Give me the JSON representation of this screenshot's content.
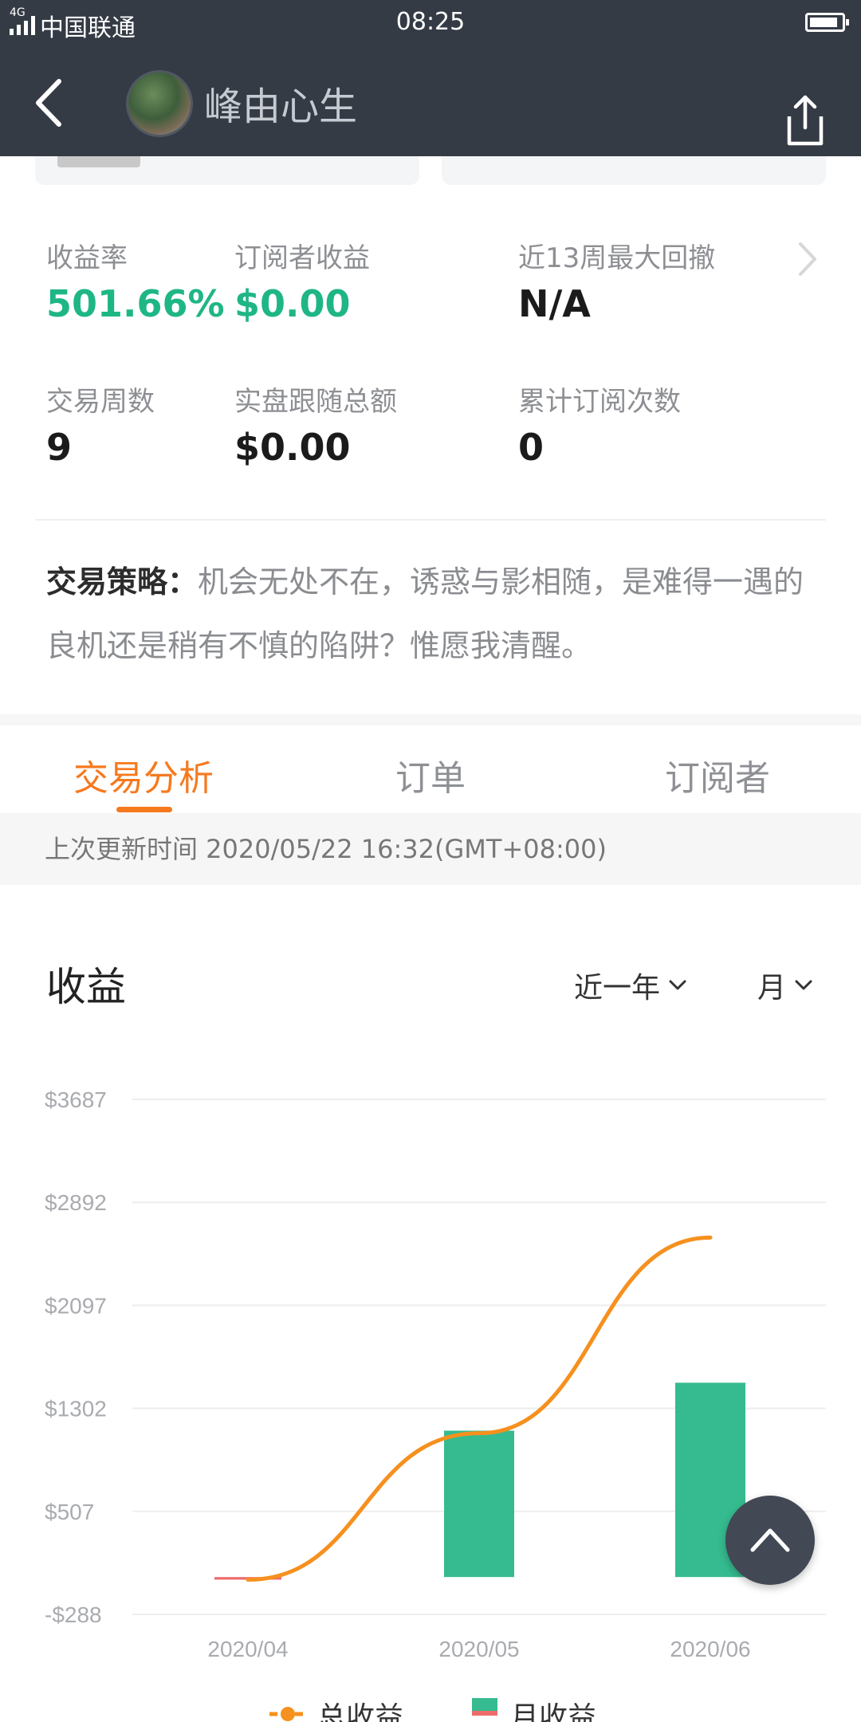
{
  "status_bar": {
    "network": "4G",
    "carrier": "中国联通",
    "time": "08:25"
  },
  "header": {
    "title": "峰由心生",
    "back_icon": "chevron-left-icon",
    "share_icon": "share-icon"
  },
  "stats": [
    {
      "label": "收益率",
      "value": "501.66%",
      "color": "#1fb686"
    },
    {
      "label": "订阅者收益",
      "value": "$0.00",
      "color": "#1fb686"
    },
    {
      "label": "近13周最大回撤",
      "value": "N/A"
    },
    {
      "label": "交易周数",
      "value": "9"
    },
    {
      "label": "实盘跟随总额",
      "value": "$0.00"
    },
    {
      "label": "累计订阅次数",
      "value": "0"
    }
  ],
  "strategy": {
    "label": "交易策略：",
    "text": "机会无处不在，诱惑与影相随，是难得一遇的良机还是稍有不慎的陷阱？惟愿我清醒。"
  },
  "tabs": [
    {
      "label": "交易分析",
      "active": true
    },
    {
      "label": "订单",
      "active": false
    },
    {
      "label": "订阅者",
      "active": false
    }
  ],
  "update_text": "上次更新时间 2020/05/22 16:32(GMT+08:00)",
  "chart_section": {
    "title": "收益",
    "range_select": "近一年",
    "period_select": "月"
  },
  "chart_data": {
    "type": "bar",
    "categories": [
      "2020/04",
      "2020/05",
      "2020/06"
    ],
    "y_ticks": [
      "$3687",
      "$2892",
      "$2097",
      "$1302",
      "$507",
      "-$288"
    ],
    "ylim": [
      -288,
      3687
    ],
    "series": [
      {
        "name": "月收益",
        "type": "bar",
        "color": "#35bb8f",
        "values": [
          -20,
          1130,
          1500
        ]
      },
      {
        "name": "总收益",
        "type": "line",
        "color": "#f6901e",
        "values": [
          -20,
          1110,
          2620
        ]
      }
    ],
    "legend": [
      "总收益",
      "月收益"
    ],
    "grid": true,
    "legend_position": "bottom"
  },
  "colors": {
    "accent": "#f6791e",
    "header_bg": "#353b45",
    "positive": "#1fb686"
  }
}
